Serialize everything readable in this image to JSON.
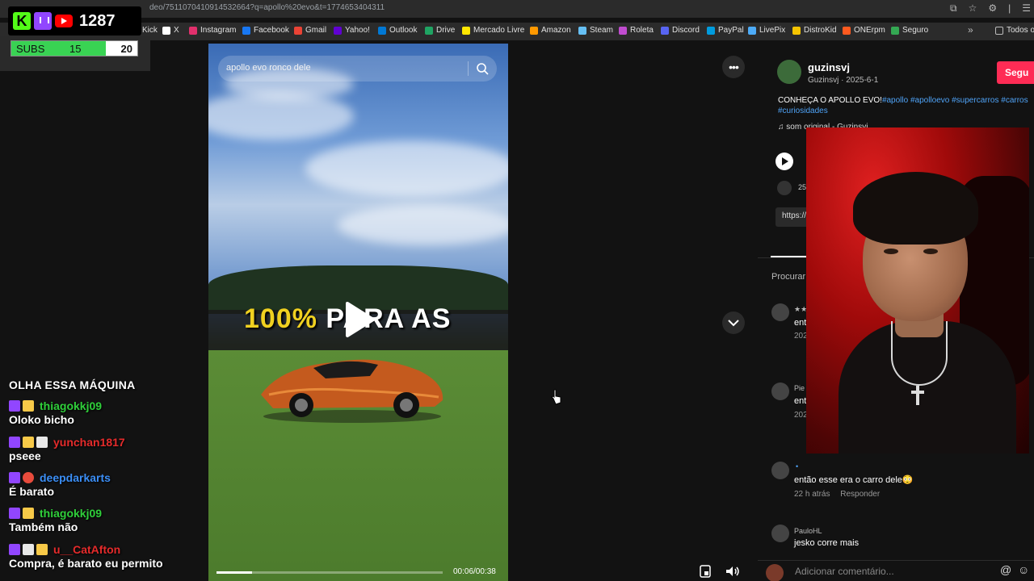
{
  "browser": {
    "url": "deo/7511070410914532664?q=apollo%20evo&t=1774653404311",
    "bookmarks": [
      {
        "label": "Kick",
        "icon": "kick-icon",
        "color": "#53fc18"
      },
      {
        "label": "X",
        "icon": "x-icon",
        "color": "#ffffff"
      },
      {
        "label": "Instagram",
        "icon": "instagram-icon",
        "color": "#e1306c"
      },
      {
        "label": "Facebook",
        "icon": "facebook-icon",
        "color": "#1877f2"
      },
      {
        "label": "Gmail",
        "icon": "gmail-icon",
        "color": "#ea4335"
      },
      {
        "label": "Yahoo!",
        "icon": "yahoo-icon",
        "color": "#6001d2"
      },
      {
        "label": "Outlook",
        "icon": "outlook-icon",
        "color": "#0078d4"
      },
      {
        "label": "Drive",
        "icon": "drive-icon",
        "color": "#1fa463"
      },
      {
        "label": "Mercado Livre",
        "icon": "mercadolivre-icon",
        "color": "#ffe600"
      },
      {
        "label": "Amazon",
        "icon": "amazon-icon",
        "color": "#ff9900"
      },
      {
        "label": "Steam",
        "icon": "steam-icon",
        "color": "#66c0f4"
      },
      {
        "label": "Roleta",
        "icon": "roleta-icon",
        "color": "#c04ccf"
      },
      {
        "label": "Discord",
        "icon": "discord-icon",
        "color": "#5865f2"
      },
      {
        "label": "PayPal",
        "icon": "paypal-icon",
        "color": "#009cde"
      },
      {
        "label": "LivePix",
        "icon": "livepix-icon",
        "color": "#4dabf7"
      },
      {
        "label": "DistroKid",
        "icon": "distrokid-icon",
        "color": "#f5c400"
      },
      {
        "label": "ONErpm",
        "icon": "onerpm-icon",
        "color": "#ff5a1f"
      },
      {
        "label": "Seguro",
        "icon": "seguro-icon",
        "color": "#34a853"
      }
    ],
    "all_bookmarks": "Todos os"
  },
  "overlay": {
    "viewer_count": "1287",
    "subs_label": "SUBS",
    "subs_current": "15",
    "subs_goal": "20",
    "subs_progress": 0.75
  },
  "video": {
    "search_placeholder": "apollo evo ronco dele",
    "caption_highlight": "100%",
    "caption_rest": "PARA AS",
    "time": "00:06/00:38",
    "progress": 0.158
  },
  "post": {
    "username": "guzinsvj",
    "subline": "Guzinsvj · 2025-6-1",
    "follow_label": "Segu",
    "desc_plain": "CONHEÇA O APOLLO EVO!",
    "desc_tags": "#apollo #apolloevo #supercarros #carros",
    "desc_tags2": "#curiosidades",
    "sound": "♫  som original - Guzinsvj",
    "likes": "25",
    "link": "https://"
  },
  "comments": {
    "section_label": "Procurar",
    "items": [
      {
        "name": "★★",
        "text": "ent",
        "meta": "202"
      },
      {
        "name": "Pie",
        "text": "ent",
        "meta": "202"
      },
      {
        "name": "•",
        "text": "então esse era o carro dele😳",
        "time": "22 h atrás",
        "reply": "Responder"
      },
      {
        "name": "PauloHL",
        "text": "jesko corre mais"
      }
    ],
    "input_placeholder": "Adicionar comentário..."
  },
  "chat": {
    "title": "OLHA ESSA MÁQUINA",
    "messages": [
      {
        "user": "thiagokkj09",
        "color": "#2fcf3a",
        "text": "Oloko bicho"
      },
      {
        "user": "yunchan1817",
        "color": "#e52b2b",
        "text": "pseee"
      },
      {
        "user": "deepdarkarts",
        "color": "#3b8ef5",
        "text": "É barato"
      },
      {
        "user": "thiagokkj09",
        "color": "#2fcf3a",
        "text": "Também não"
      },
      {
        "user": "u__CatAfton",
        "color": "#e52b2b",
        "text": "Compra, é barato eu permito"
      }
    ]
  }
}
